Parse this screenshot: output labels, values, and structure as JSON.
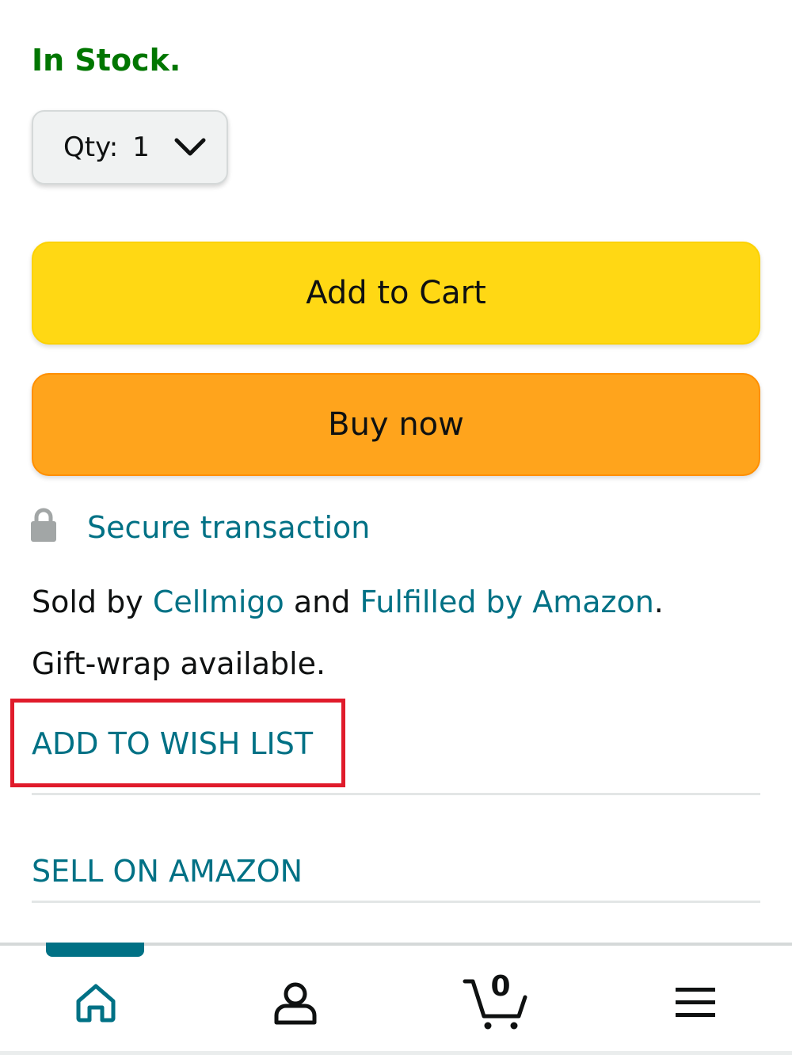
{
  "availability": {
    "text": "In Stock.",
    "color": "#007600"
  },
  "quantity": {
    "label": "Qty:",
    "value": "1"
  },
  "buttons": {
    "add_to_cart": "Add to Cart",
    "buy_now": "Buy now",
    "add_to_cart_color": "#ffd814",
    "buy_now_color": "#ffa41c"
  },
  "secure": {
    "text": "Secure transaction",
    "icon": "lock-icon"
  },
  "seller": {
    "prefix": "Sold by ",
    "seller_name": "Cellmigo",
    "middle": " and ",
    "fulfillment": "Fulfilled by Amazon",
    "suffix": "."
  },
  "gift": {
    "text": "Gift-wrap available."
  },
  "links": {
    "wish_list": "ADD TO WISH LIST",
    "sell": "SELL ON AMAZON"
  },
  "highlight": {
    "target": "wish_list",
    "color": "#e01b2b"
  },
  "bottom_nav": {
    "items": [
      {
        "name": "home",
        "icon": "home-icon",
        "active": true
      },
      {
        "name": "account",
        "icon": "user-icon",
        "active": false
      },
      {
        "name": "cart",
        "icon": "cart-icon",
        "active": false,
        "count": "0"
      },
      {
        "name": "menu",
        "icon": "menu-icon",
        "active": false
      }
    ],
    "accent_color": "#007185"
  }
}
